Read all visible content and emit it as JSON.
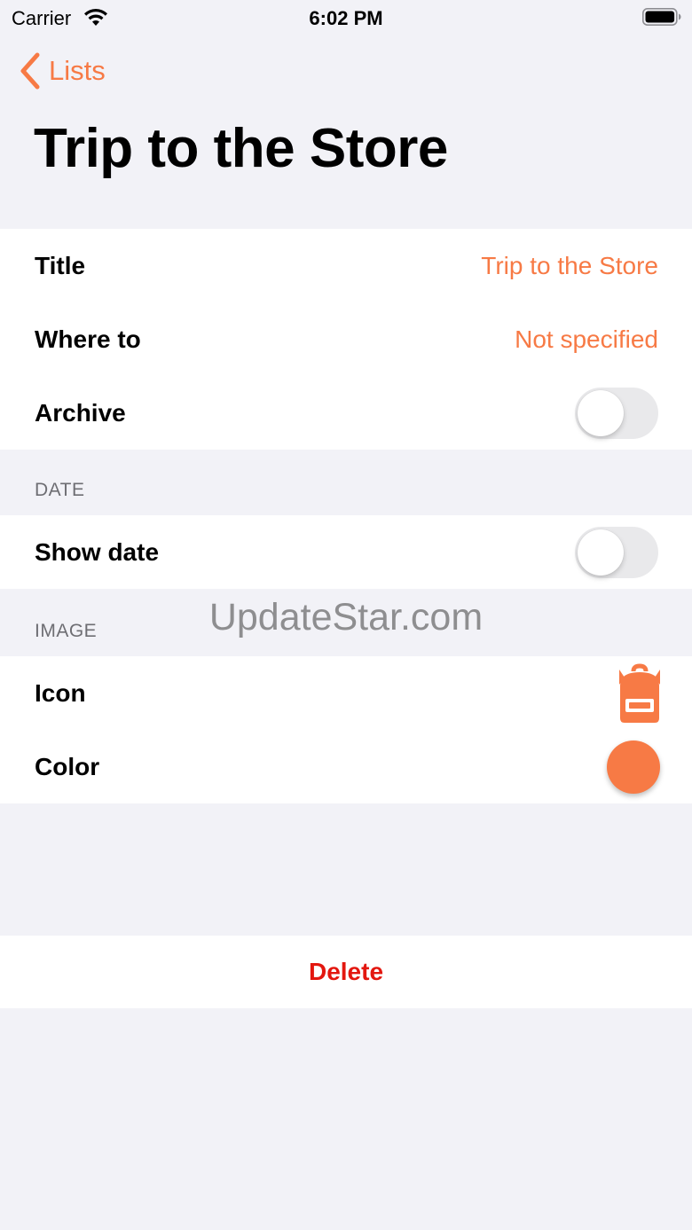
{
  "status_bar": {
    "carrier": "Carrier",
    "time": "6:02 PM",
    "wifi_icon": "wifi-icon",
    "battery_icon": "battery-icon"
  },
  "nav": {
    "back_label": "Lists",
    "back_icon": "chevron-left-icon",
    "title": "Trip to the Store"
  },
  "details": {
    "title_label": "Title",
    "title_value": "Trip to the Store",
    "where_label": "Where to",
    "where_value": "Not specified",
    "archive_label": "Archive",
    "archive_on": false
  },
  "date_section": {
    "header": "DATE",
    "show_date_label": "Show date",
    "show_date_on": false
  },
  "image_section": {
    "header": "IMAGE",
    "icon_label": "Icon",
    "icon_name": "backpack-icon",
    "color_label": "Color",
    "color_value": "#f77a45"
  },
  "actions": {
    "delete_label": "Delete"
  },
  "watermark": "UpdateStar.com",
  "colors": {
    "accent": "#f77a45",
    "destructive": "#e3170f",
    "background": "#f2f2f7"
  }
}
